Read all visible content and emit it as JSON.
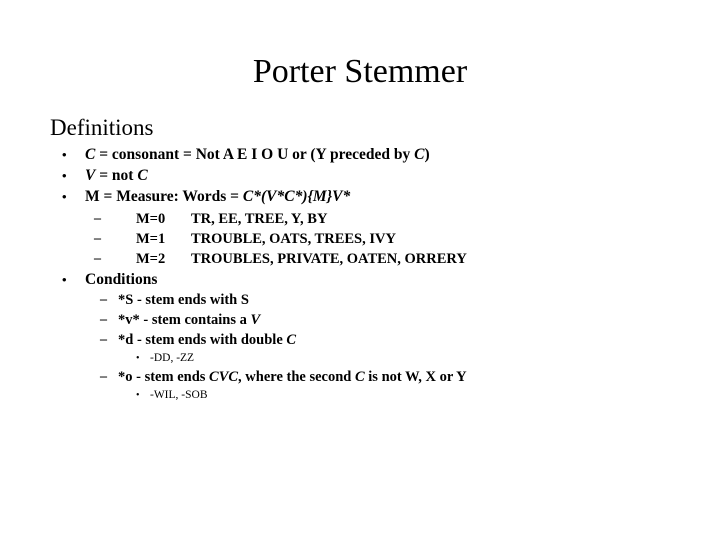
{
  "slide": {
    "title": "Porter Stemmer",
    "section_heading": "Definitions",
    "bullet_marker": "•",
    "dash_marker": "–",
    "dot_marker": "•",
    "definitions": [
      {
        "pre": "",
        "sym1": "C",
        "mid": " = consonant = Not A E I O U or (Y preceded by ",
        "sym2": "C",
        "post": ")"
      },
      {
        "pre": "",
        "sym1": "V",
        "mid": " = not ",
        "sym2": "C",
        "post": ""
      }
    ],
    "measure": {
      "lead": "M = Measure: Words = ",
      "formula_c1": "C",
      "formula_star1": "*(",
      "formula_v1": "V",
      "formula_star2": "*",
      "formula_c2": "C",
      "formula_star3": "*){",
      "formula_m": "M",
      "formula_star4": "}",
      "formula_v2": "V",
      "formula_star5": "*",
      "rows": [
        {
          "label": "M=0",
          "examples": "TR,  EE,  TREE,  Y,  BY"
        },
        {
          "label": "M=1",
          "examples": "TROUBLE,  OATS,  TREES,  IVY"
        },
        {
          "label": "M=2",
          "examples": "TROUBLES,  PRIVATE,  OATEN,  ORRERY"
        }
      ]
    },
    "conditions": {
      "heading": "Conditions",
      "items": [
        {
          "code": "*S",
          "text": " - stem ends with S",
          "sym": "",
          "tail": "",
          "subs": []
        },
        {
          "code": "*v*",
          "text": " - stem contains a ",
          "sym": "V",
          "tail": "",
          "subs": []
        },
        {
          "code": "*d",
          "text": " - stem ends with double ",
          "sym": "C",
          "tail": "",
          "subs": [
            "-DD, -ZZ"
          ]
        },
        {
          "code": "*o",
          "text": " - stem ends ",
          "sym": "CVC",
          "tail": ", where the second ",
          "sym2": "C",
          "tail2": " is not W, X or Y",
          "subs": [
            "-WIL, -SOB"
          ]
        }
      ]
    }
  }
}
